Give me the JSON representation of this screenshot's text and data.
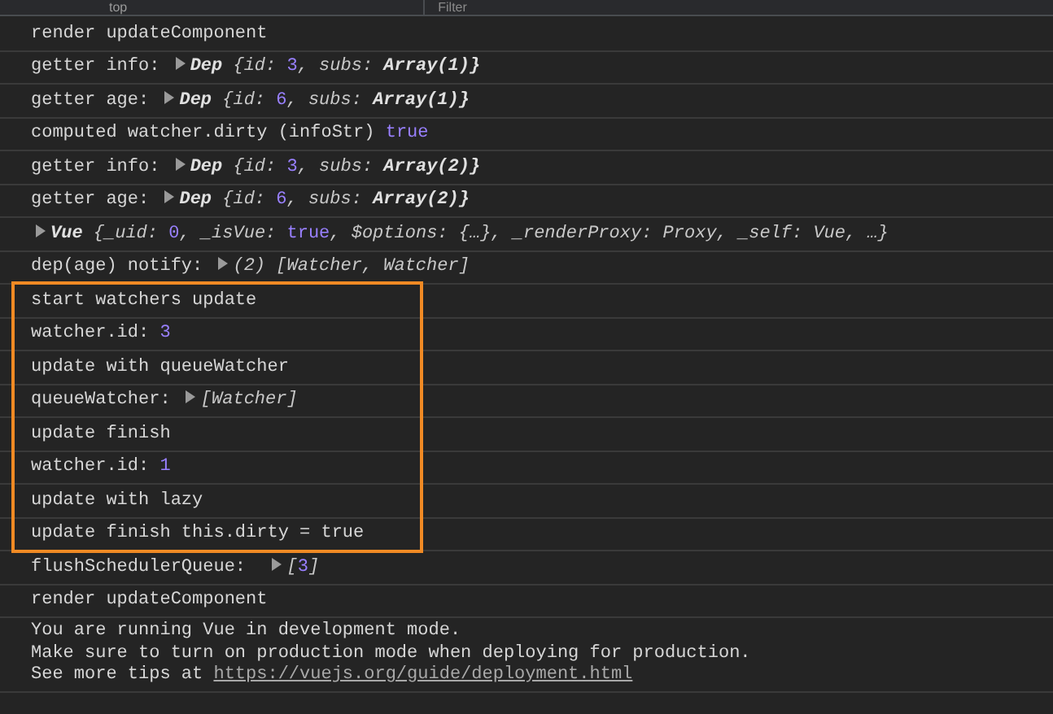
{
  "toolbar": {
    "context": "top",
    "filter": {
      "placeholder": "Filter"
    }
  },
  "console": [
    {
      "kind": "plain",
      "messages": [
        {
          "segments": [
            {
              "kind": "text",
              "text": "render updateComponent"
            }
          ]
        },
        {
          "segments": [
            {
              "kind": "text",
              "text": "getter info: "
            },
            {
              "kind": "toggle"
            },
            {
              "kind": "objname",
              "text": "Dep "
            },
            {
              "kind": "obj",
              "text": "{id: "
            },
            {
              "kind": "num",
              "text": "3"
            },
            {
              "kind": "obj",
              "text": ", subs: "
            },
            {
              "kind": "objname",
              "text": "Array(1)}"
            }
          ]
        },
        {
          "segments": [
            {
              "kind": "text",
              "text": "getter age: "
            },
            {
              "kind": "toggle"
            },
            {
              "kind": "objname",
              "text": "Dep "
            },
            {
              "kind": "obj",
              "text": "{id: "
            },
            {
              "kind": "num",
              "text": "6"
            },
            {
              "kind": "obj",
              "text": ", subs: "
            },
            {
              "kind": "objname",
              "text": "Array(1)}"
            }
          ]
        },
        {
          "segments": [
            {
              "kind": "text",
              "text": "computed watcher.dirty (infoStr) "
            },
            {
              "kind": "num",
              "text": "true"
            }
          ]
        },
        {
          "segments": [
            {
              "kind": "text",
              "text": "getter info: "
            },
            {
              "kind": "toggle"
            },
            {
              "kind": "objname",
              "text": "Dep "
            },
            {
              "kind": "obj",
              "text": "{id: "
            },
            {
              "kind": "num",
              "text": "3"
            },
            {
              "kind": "obj",
              "text": ", subs: "
            },
            {
              "kind": "objname",
              "text": "Array(2)}"
            }
          ]
        },
        {
          "segments": [
            {
              "kind": "text",
              "text": "getter age: "
            },
            {
              "kind": "toggle"
            },
            {
              "kind": "objname",
              "text": "Dep "
            },
            {
              "kind": "obj",
              "text": "{id: "
            },
            {
              "kind": "num",
              "text": "6"
            },
            {
              "kind": "obj",
              "text": ", subs: "
            },
            {
              "kind": "objname",
              "text": "Array(2)}"
            }
          ]
        },
        {
          "segments": [
            {
              "kind": "toggle"
            },
            {
              "kind": "objname",
              "text": "Vue "
            },
            {
              "kind": "obj",
              "text": "{_uid: "
            },
            {
              "kind": "num",
              "text": "0"
            },
            {
              "kind": "obj",
              "text": ", _isVue: "
            },
            {
              "kind": "num",
              "text": "true"
            },
            {
              "kind": "obj",
              "text": ", $options: {…}, _renderProxy: Proxy, _self: Vue, …}"
            }
          ]
        },
        {
          "segments": [
            {
              "kind": "text",
              "text": "dep(age) notify: "
            },
            {
              "kind": "toggle"
            },
            {
              "kind": "obj",
              "text": "(2) [Watcher, Watcher]"
            }
          ]
        }
      ]
    },
    {
      "kind": "boxed",
      "messages": [
        {
          "segments": [
            {
              "kind": "text",
              "text": "start watchers update"
            }
          ]
        },
        {
          "segments": [
            {
              "kind": "text",
              "text": "watcher.id: "
            },
            {
              "kind": "num",
              "text": "3"
            }
          ]
        },
        {
          "segments": [
            {
              "kind": "text",
              "text": "update with queueWatcher"
            }
          ]
        },
        {
          "segments": [
            {
              "kind": "text",
              "text": "queueWatcher: "
            },
            {
              "kind": "toggle"
            },
            {
              "kind": "obj",
              "text": "[Watcher]"
            }
          ]
        },
        {
          "segments": [
            {
              "kind": "text",
              "text": "update finish"
            }
          ]
        },
        {
          "segments": [
            {
              "kind": "text",
              "text": "watcher.id: "
            },
            {
              "kind": "num",
              "text": "1"
            }
          ]
        },
        {
          "segments": [
            {
              "kind": "text",
              "text": "update with lazy"
            }
          ]
        },
        {
          "segments": [
            {
              "kind": "text",
              "text": "update finish this.dirty = true"
            }
          ]
        }
      ]
    },
    {
      "kind": "plain",
      "messages": [
        {
          "segments": [
            {
              "kind": "text",
              "text": "flushSchedulerQueue:  "
            },
            {
              "kind": "toggle"
            },
            {
              "kind": "obj",
              "text": "["
            },
            {
              "kind": "num",
              "text": "3"
            },
            {
              "kind": "obj",
              "text": "]"
            }
          ]
        },
        {
          "segments": [
            {
              "kind": "text",
              "text": "render updateComponent"
            }
          ]
        },
        {
          "lines": [
            [
              {
                "kind": "text",
                "text": "You are running Vue in development mode."
              }
            ],
            [
              {
                "kind": "text",
                "text": "Make sure to turn on production mode when deploying for production."
              }
            ],
            [
              {
                "kind": "text",
                "text": "See more tips at "
              },
              {
                "kind": "link",
                "text": "https://vuejs.org/guide/deployment.html"
              }
            ]
          ]
        }
      ]
    }
  ]
}
